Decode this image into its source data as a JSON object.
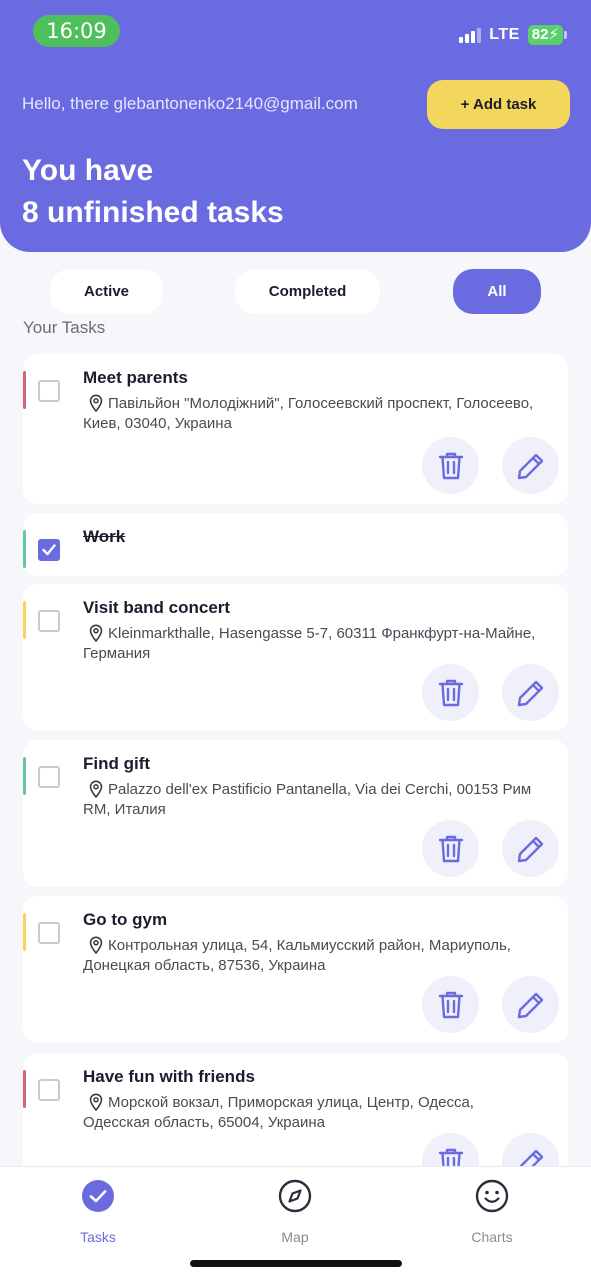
{
  "status_bar": {
    "time": "16:09",
    "network": "LTE",
    "battery": "82"
  },
  "header": {
    "greeting": "Hello, there glebantonenko2140@gmail.com",
    "add_button": "+ Add task",
    "headline_line1": "You have",
    "headline_line2": "8 unfinished tasks"
  },
  "filters": {
    "active": "Active",
    "completed": "Completed",
    "all": "All",
    "selected": "All"
  },
  "section_title": "Your Tasks",
  "tasks": [
    {
      "title": "Meet parents",
      "address": "Павільйон \"Молодіжний\", Голосеевский проспект, Голосеево, Киев, 03040, Украина",
      "completed": false,
      "color": "#d9657b"
    },
    {
      "title": "Work",
      "address": "",
      "completed": true,
      "color": "#63c7a6"
    },
    {
      "title": "Visit band concert",
      "address": "Kleinmarkthalle, Hasengasse 5-7, 60311 Франкфурт-на-Майне, Германия",
      "completed": false,
      "color": "#f0d65a"
    },
    {
      "title": "Find gift",
      "address": "Palazzo dell'ex Pastificio Pantanella, Via dei Cerchi, 00153 Рим RM, Италия",
      "completed": false,
      "color": "#63c7a6"
    },
    {
      "title": "Go to gym",
      "address": "Контрольная улица, 54, Кальмиусский район, Мариуполь, Донецкая область, 87536, Украина",
      "completed": false,
      "color": "#f0d65a"
    },
    {
      "title": "Have fun with friends",
      "address": "Морской вокзал, Приморская улица, Центр, Одесса, Одесская область, 65004, Украина",
      "completed": false,
      "color": "#d9657b"
    }
  ],
  "nav": {
    "tasks": "Tasks",
    "map": "Map",
    "charts": "Charts",
    "selected": "Tasks"
  },
  "colors": {
    "primary": "#6a6be0",
    "accent": "#f3d65c",
    "status_green": "#4fbf5c"
  }
}
